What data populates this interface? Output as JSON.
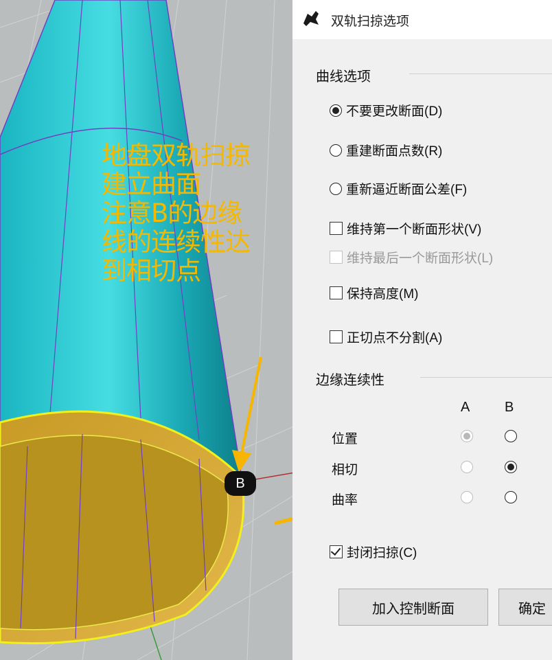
{
  "annotation": {
    "text": "地盘双轨扫掠\n建立曲面\n注意B的边缘\n线的连续性达\n到相切点",
    "badge": "B"
  },
  "dialog": {
    "title": "双轨扫掠选项",
    "curve_options": {
      "label": "曲线选项",
      "radios": [
        {
          "label": "不要更改断面(D)",
          "selected": true
        },
        {
          "label": "重建断面点数(R)",
          "selected": false
        },
        {
          "label": "重新逼近断面公差(F)",
          "selected": false
        }
      ],
      "checkboxes": [
        {
          "label": "维持第一个断面形状(V)",
          "checked": false,
          "enabled": true
        },
        {
          "label": "维持最后一个断面形状(L)",
          "checked": false,
          "enabled": false
        },
        {
          "label": "保持高度(M)",
          "checked": false,
          "enabled": true
        },
        {
          "label": "正切点不分割(A)",
          "checked": false,
          "enabled": true
        }
      ]
    },
    "edge_continuity": {
      "label": "边缘连续性",
      "col_a": "A",
      "col_b": "B",
      "rows": [
        {
          "label": "位置",
          "a": "selected-disabled",
          "b": "off"
        },
        {
          "label": "相切",
          "a": "off-disabled",
          "b": "selected"
        },
        {
          "label": "曲率",
          "a": "off-disabled",
          "b": "off"
        }
      ]
    },
    "closed_sweep": {
      "label": "封闭扫掠(C)",
      "checked": true
    },
    "buttons": {
      "add_section": "加入控制断面",
      "ok": "确定"
    }
  },
  "colors": {
    "annotation": "#f5b800",
    "surface_cyan": "#22c4cc",
    "surface_gold": "#d6a92c",
    "arrow": "#f7b500"
  }
}
